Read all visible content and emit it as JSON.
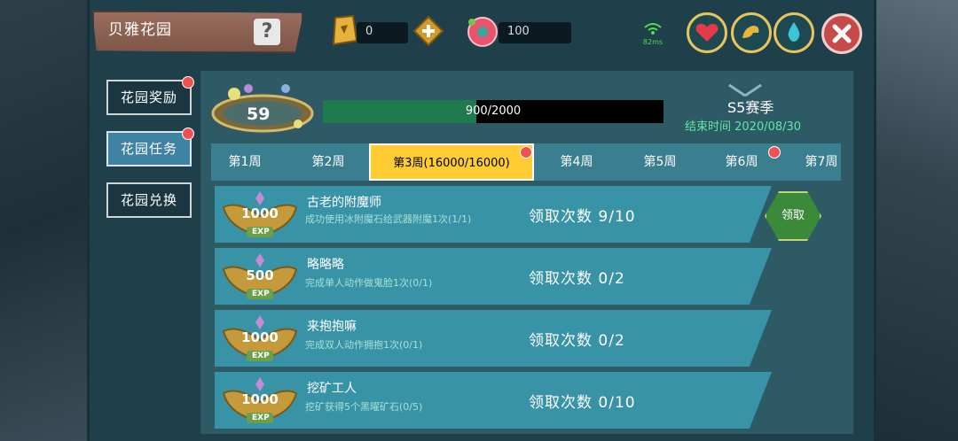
{
  "header": {
    "title": "贝雅花园",
    "help_label": "?",
    "gold_value": "0",
    "flower_value": "100",
    "ping": "82ms"
  },
  "side_tabs": [
    {
      "label": "花园奖励",
      "active": false,
      "dot": true
    },
    {
      "label": "花园任务",
      "active": true,
      "dot": true
    },
    {
      "label": "花园兑换",
      "active": false,
      "dot": false
    }
  ],
  "level": "59",
  "progress": {
    "text": "900/2000",
    "current": 900,
    "max": 2000
  },
  "season": {
    "title": "S5赛季",
    "end_text": "结束时间 2020/08/30"
  },
  "weeks": [
    {
      "label": "第1周"
    },
    {
      "label": "第2周"
    },
    {
      "label": "第3周(16000/16000)"
    },
    {
      "label": "第4周"
    },
    {
      "label": "第5周"
    },
    {
      "label": "第6周"
    },
    {
      "label": "第7周"
    }
  ],
  "quests": [
    {
      "title": "古老的附魔师",
      "desc": "成功使用冰附魔石给武器附魔1次(1/1)",
      "count": "领取次数 9/10",
      "reward": "1000",
      "exp": "EXP"
    },
    {
      "title": "略略略",
      "desc": "完成单人动作做鬼脸1次(0/1)",
      "count": "领取次数 0/2",
      "reward": "500",
      "exp": "EXP"
    },
    {
      "title": "来抱抱嘛",
      "desc": "完成双人动作拥抱1次(0/1)",
      "count": "领取次数 0/2",
      "reward": "1000",
      "exp": "EXP"
    },
    {
      "title": "挖矿工人",
      "desc": "挖矿获得5个黑曜矿石(0/5)",
      "count": "领取次数 0/10",
      "reward": "1000",
      "exp": "EXP"
    }
  ],
  "claim_label": "领取",
  "icons": {
    "gold": "gold-bar-icon",
    "plus": "plus-icon",
    "flower": "flower-icon",
    "wifi": "wifi-icon",
    "heart": "heart-icon",
    "arm": "arm-icon",
    "water": "water-drop-icon",
    "close": "close-icon"
  },
  "colors": {
    "accent_gold": "#ffcc33",
    "quest_bg": "#3993a7",
    "progress": "#1f7a4e",
    "season_green": "#5fe6a8",
    "dot_red": "#f05252"
  }
}
